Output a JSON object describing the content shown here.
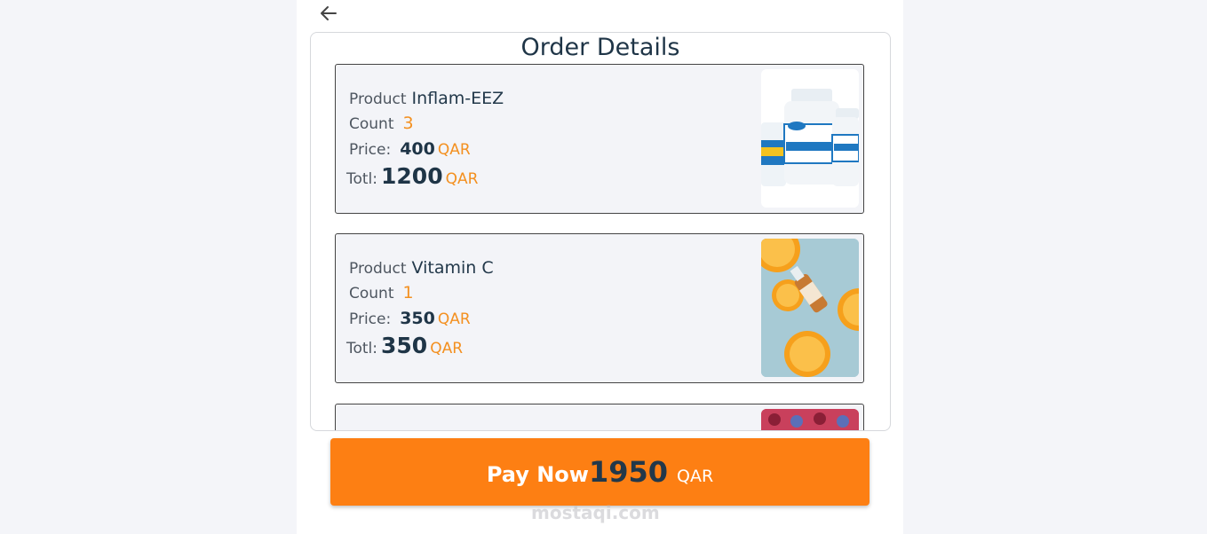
{
  "header": {
    "back_icon": "arrow-left-icon"
  },
  "order": {
    "title": "Order Details",
    "items": [
      {
        "product_label": "Product",
        "product": "Inflam-EEZ",
        "count_label": "Count",
        "count": "3",
        "price_label": "Price:",
        "price": "400",
        "price_currency": "QAR",
        "total_label": "Totl:",
        "total": "1200",
        "total_currency": "QAR",
        "image": "supplement-bottles"
      },
      {
        "product_label": "Product",
        "product": "Vitamin C",
        "count_label": "Count",
        "count": "1",
        "price_label": "Price:",
        "price": "350",
        "price_currency": "QAR",
        "total_label": "Totl:",
        "total": "350",
        "total_currency": "QAR",
        "image": "orange-serum"
      }
    ]
  },
  "pay": {
    "label": "Pay Now",
    "amount": "1950",
    "currency": "QAR"
  },
  "watermark": "mostaqi.com",
  "colors": {
    "accent": "#fd7f13",
    "text_dark": "#1f3547",
    "currency": "#f39020"
  }
}
